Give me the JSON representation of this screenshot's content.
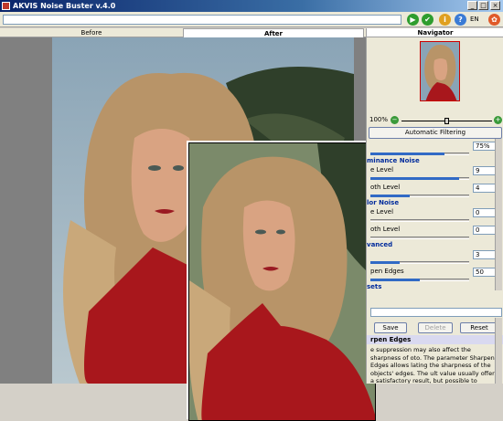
{
  "window": {
    "title": "AKVIS Noise Buster v.4.0"
  },
  "toolbar": {
    "language": "EN"
  },
  "tabs": [
    {
      "label": "Before"
    },
    {
      "label": "After"
    }
  ],
  "navigator": {
    "title": "Navigator",
    "zoom": "100%"
  },
  "panel": {
    "auto_filter_label": "Automatic Filtering",
    "general": {
      "value": "75%"
    },
    "luminance": {
      "title": "minance Noise",
      "rows": [
        {
          "label": "e Level",
          "value": "9"
        },
        {
          "label": "oth Level",
          "value": "4"
        }
      ]
    },
    "color": {
      "title": "lor Noise",
      "rows": [
        {
          "label": "e Level",
          "value": "0"
        },
        {
          "label": "oth Level",
          "value": "0"
        }
      ]
    },
    "advanced": {
      "title": "vanced",
      "rows": [
        {
          "label": "",
          "value": "3"
        },
        {
          "label": "pen Edges",
          "value": "50"
        }
      ]
    },
    "presets_title": "sets",
    "buttons": {
      "save": "Save",
      "delete": "Delete",
      "reset": "Reset"
    },
    "help": {
      "title": "rpen Edges",
      "text": "e suppression may also affect the sharpness of oto. The parameter Sharpen Edges allows lating the sharpness of the objects' edges. The ult value usually offers a satisfactory result, but possible to increase the value of the parameter prove sharpness. However, it may also cause"
    }
  },
  "colors": {
    "accent": "#316ac5",
    "section": "#002b9c",
    "title_bar": "#0a246a"
  }
}
